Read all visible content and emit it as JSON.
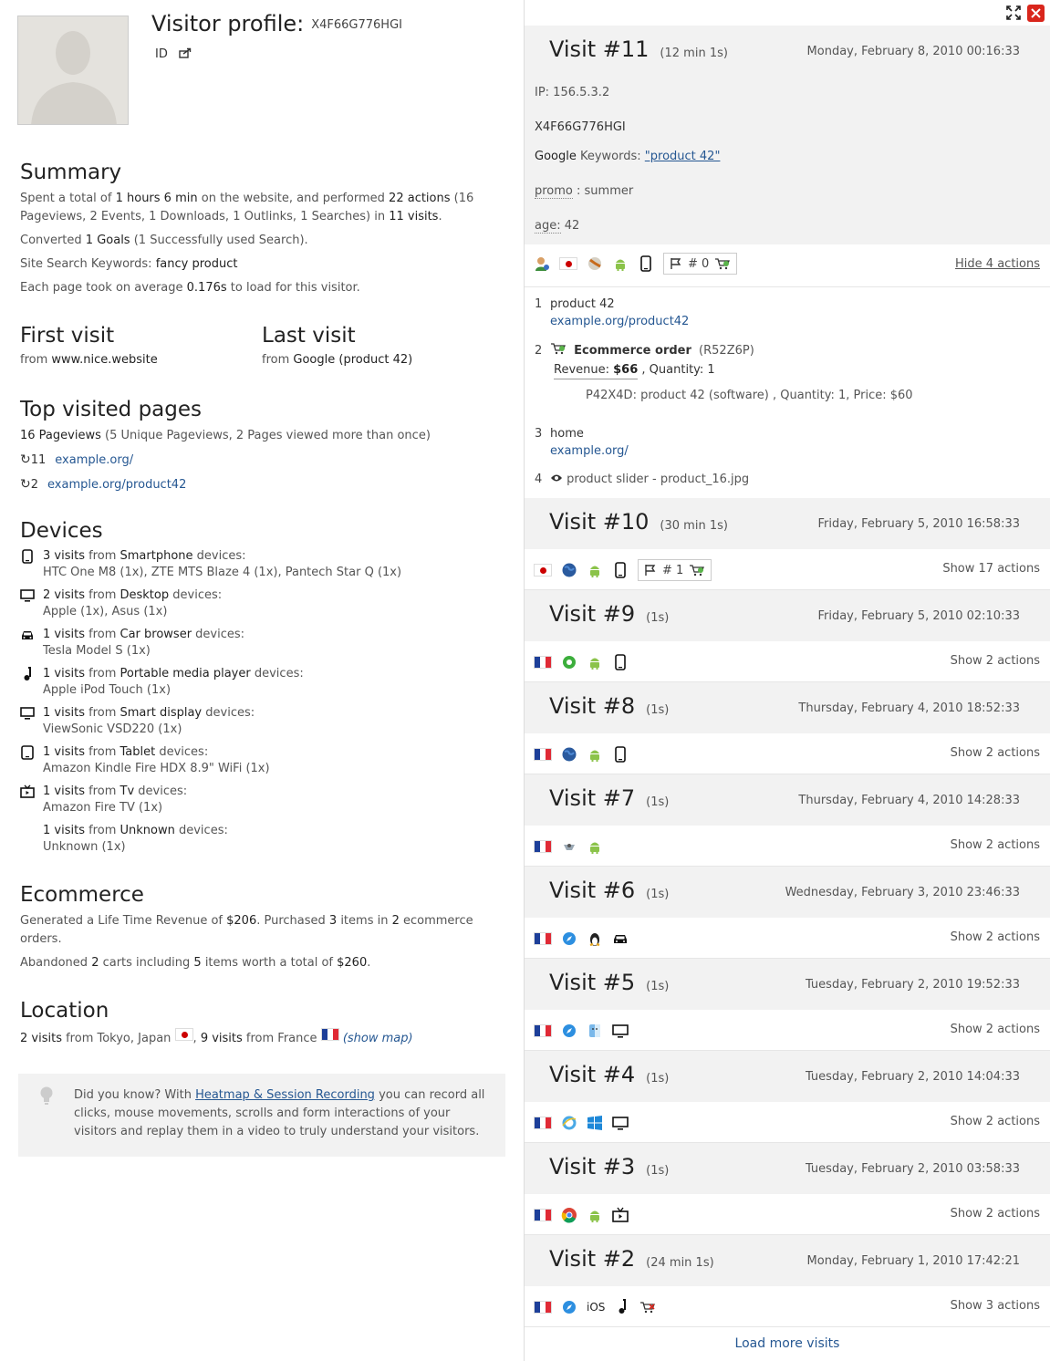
{
  "profile": {
    "title": "Visitor profile:",
    "visitor_id": "X4F66G776HGI",
    "id_label": "ID"
  },
  "summary": {
    "heading": "Summary",
    "l1_a": "Spent a total of ",
    "l1_time": "1 hours 6 min",
    "l1_b": " on the website, and performed ",
    "l1_actions": "22 actions",
    "l1_c": " (16 Pageviews, 2 Events, 1 Downloads, 1 Outlinks, 1 Searches) in ",
    "l1_visits": "11 visits",
    "l1_d": ".",
    "l2_a": "Converted ",
    "l2_goals": "1 Goals",
    "l2_b": " (1 Successfully used Search).",
    "l3_a": "Site Search Keywords: ",
    "l3_kw": "fancy product",
    "l4_a": "Each page took on average ",
    "l4_val": "0.176s",
    "l4_b": " to load for this visitor."
  },
  "first_visit": {
    "heading": "First visit",
    "from": "from ",
    "source": "www.nice.website"
  },
  "last_visit": {
    "heading": "Last visit",
    "from": "from ",
    "source": "Google (product 42)"
  },
  "top_pages": {
    "heading": "Top visited pages",
    "pv": "16 Pageviews",
    "pv_detail": " (5 Unique Pageviews, 2 Pages viewed more than once)",
    "items": [
      {
        "count": "11",
        "url": "example.org/"
      },
      {
        "count": "2",
        "url": "example.org/product42"
      }
    ]
  },
  "devices": {
    "heading": "Devices",
    "items": [
      {
        "icon": "smartphone-icon",
        "count": "3 visits",
        "mid": " from ",
        "type": "Smartphone",
        "tail": " devices:",
        "models": "HTC One M8 (1x), ZTE MTS Blaze 4 (1x), Pantech Star Q (1x)"
      },
      {
        "icon": "desktop-icon",
        "count": "2 visits",
        "mid": " from ",
        "type": "Desktop",
        "tail": " devices:",
        "models": "Apple (1x), Asus (1x)"
      },
      {
        "icon": "car-icon",
        "count": "1 visits",
        "mid": " from ",
        "type": "Car browser",
        "tail": " devices:",
        "models": "Tesla Model S (1x)"
      },
      {
        "icon": "music-note-icon",
        "count": "1 visits",
        "mid": " from ",
        "type": "Portable media player",
        "tail": " devices:",
        "models": "Apple iPod Touch (1x)"
      },
      {
        "icon": "smart-display-icon",
        "count": "1 visits",
        "mid": " from ",
        "type": "Smart display",
        "tail": " devices:",
        "models": "ViewSonic VSD220 (1x)"
      },
      {
        "icon": "tablet-icon",
        "count": "1 visits",
        "mid": " from ",
        "type": "Tablet",
        "tail": " devices:",
        "models": "Amazon Kindle Fire HDX 8.9\" WiFi (1x)"
      },
      {
        "icon": "tv-icon",
        "count": "1 visits",
        "mid": " from ",
        "type": "Tv",
        "tail": " devices:",
        "models": "Amazon Fire TV (1x)"
      },
      {
        "icon": "none",
        "count": "1 visits",
        "mid": " from ",
        "type": "Unknown",
        "tail": " devices:",
        "models": "Unknown (1x)"
      }
    ]
  },
  "ecommerce": {
    "heading": "Ecommerce",
    "l1_a": "Generated a Life Time Revenue of ",
    "l1_rev": "$206",
    "l1_b": ". Purchased ",
    "l1_items": "3",
    "l1_c": " items in ",
    "l1_orders": "2",
    "l1_d": " ecommerce orders.",
    "l2_a": "Abandoned ",
    "l2_carts": "2",
    "l2_b": " carts including ",
    "l2_items": "5",
    "l2_c": " items worth a total of ",
    "l2_total": "$260",
    "l2_d": "."
  },
  "location": {
    "heading": "Location",
    "v1": "2 visits",
    "f1": " from Tokyo, Japan ",
    "sep": ", ",
    "v2": "9 visits",
    "f2": " from France ",
    "map": "(show map)"
  },
  "tip": {
    "a": "Did you know? With ",
    "link": "Heatmap & Session Recording",
    "b": " you can record all clicks, mouse movements, scrolls and form interactions of your visitors and replay them in a video to truly understand your visitors."
  },
  "visit11": {
    "title": "Visit #11",
    "duration": "(12 min 1s)",
    "date": "Monday, February 8, 2010 00:16:33",
    "ip": "IP: 156.5.3.2",
    "visitor_id": "X4F66G776HGI",
    "ref_a": "Google",
    "ref_b": " Keywords: ",
    "ref_kw": "\"product 42\"",
    "cv1_name": "promo",
    "cv1_val": " : summer",
    "cv2_name": "age:",
    "cv2_val": " 42",
    "goal_count": "# 0",
    "hide": "Hide 4 actions",
    "a1_n": "1",
    "a1_title": "product 42",
    "a1_url": "example.org/product42",
    "a2_n": "2",
    "a2_title": "Ecommerce order",
    "a2_id": "(R52Z6P)",
    "a2_rev_label": "Revenue: ",
    "a2_rev": "$66",
    "a2_qty": " , Quantity: 1",
    "a2_item": "P42X4D: product 42 (software) , Quantity: 1, Price: $60",
    "a3_n": "3",
    "a3_title": "home",
    "a3_url": "example.org/",
    "a4_n": "4",
    "a4_title": "product slider - product_16.jpg"
  },
  "visits": [
    {
      "title": "Visit #10",
      "duration": "(30 min 1s)",
      "date": "Friday, February 5, 2010 16:58:33",
      "action": "Show 17 actions",
      "icons": [
        "flag-jp",
        "globe-icon",
        "android-icon",
        "smartphone-icon",
        "goal-box"
      ],
      "goal": "# 1"
    },
    {
      "title": "Visit #9",
      "duration": "(1s)",
      "date": "Friday, February 5, 2010 02:10:33",
      "action": "Show 2 actions",
      "icons": [
        "flag-fr",
        "green-browser-icon",
        "android-icon",
        "smartphone-icon"
      ]
    },
    {
      "title": "Visit #8",
      "duration": "(1s)",
      "date": "Thursday, February 4, 2010 18:52:33",
      "action": "Show 2 actions",
      "icons": [
        "flag-fr",
        "globe-icon",
        "android-icon",
        "smartphone-icon"
      ]
    },
    {
      "title": "Visit #7",
      "duration": "(1s)",
      "date": "Thursday, February 4, 2010 14:28:33",
      "action": "Show 2 actions",
      "icons": [
        "flag-fr",
        "bot-icon",
        "android-icon"
      ]
    },
    {
      "title": "Visit #6",
      "duration": "(1s)",
      "date": "Wednesday, February 3, 2010 23:46:33",
      "action": "Show 2 actions",
      "icons": [
        "flag-fr",
        "safari-icon",
        "linux-icon",
        "car-icon"
      ]
    },
    {
      "title": "Visit #5",
      "duration": "(1s)",
      "date": "Tuesday, February 2, 2010 19:52:33",
      "action": "Show 2 actions",
      "icons": [
        "flag-fr",
        "safari-icon",
        "macos-icon",
        "desktop-icon"
      ]
    },
    {
      "title": "Visit #4",
      "duration": "(1s)",
      "date": "Tuesday, February 2, 2010 14:04:33",
      "action": "Show 2 actions",
      "icons": [
        "flag-fr",
        "ie-icon",
        "windows-icon",
        "desktop-icon"
      ]
    },
    {
      "title": "Visit #3",
      "duration": "(1s)",
      "date": "Tuesday, February 2, 2010 03:58:33",
      "action": "Show 2 actions",
      "icons": [
        "flag-fr",
        "chrome-icon",
        "android-icon",
        "tv-icon"
      ]
    },
    {
      "title": "Visit #2",
      "duration": "(24 min 1s)",
      "date": "Monday, February 1, 2010 17:42:21",
      "action": "Show 3 actions",
      "icons": [
        "flag-fr",
        "safari-icon",
        "ios-label",
        "music-note-icon",
        "abandoned-cart-icon"
      ],
      "ios": "iOS"
    }
  ],
  "load_more": "Load more visits"
}
